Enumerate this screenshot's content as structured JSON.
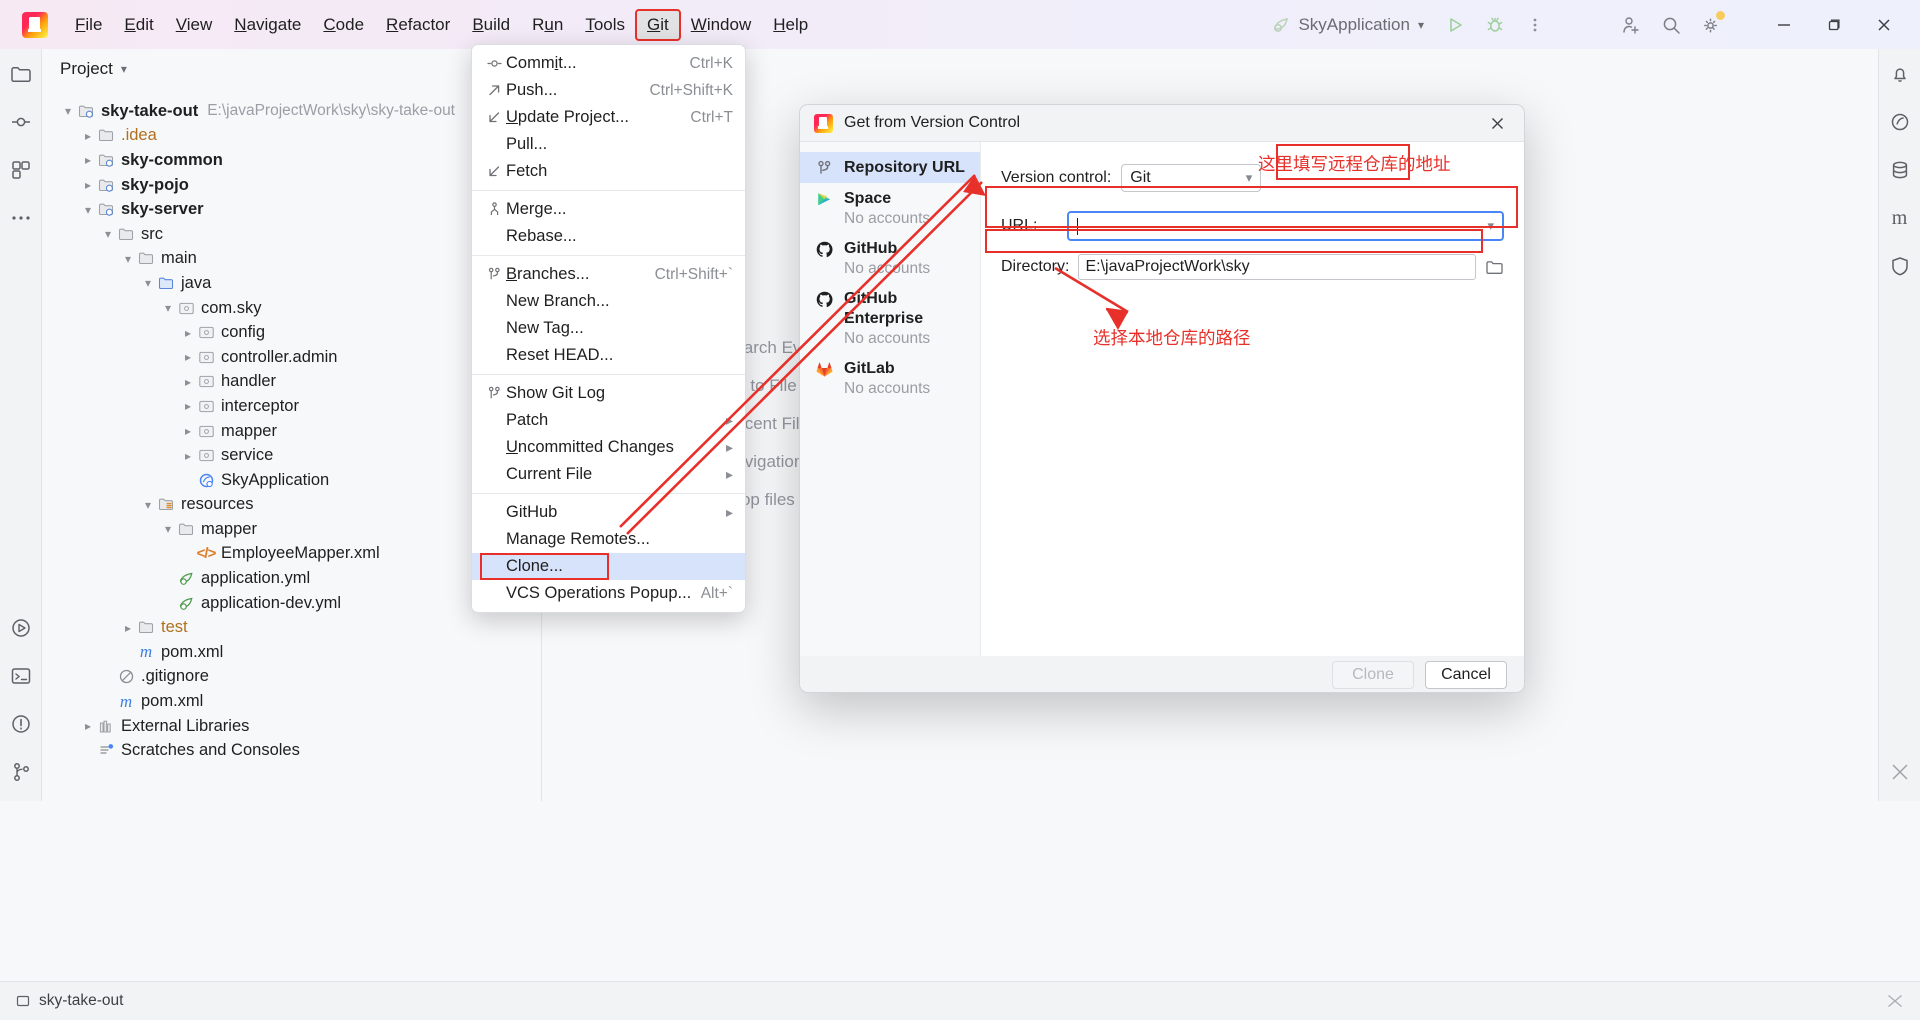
{
  "app": {
    "logo_icon": "intellij-idea-logo",
    "menubar": [
      {
        "label": "File",
        "mnemonic": "F"
      },
      {
        "label": "Edit",
        "mnemonic": "E"
      },
      {
        "label": "View",
        "mnemonic": "V"
      },
      {
        "label": "Navigate",
        "mnemonic": "N"
      },
      {
        "label": "Code",
        "mnemonic": "C"
      },
      {
        "label": "Refactor",
        "mnemonic": "R"
      },
      {
        "label": "Build",
        "mnemonic": "B"
      },
      {
        "label": "Run",
        "mnemonic": "u"
      },
      {
        "label": "Tools",
        "mnemonic": "T"
      },
      {
        "label": "Git",
        "mnemonic": "G"
      },
      {
        "label": "Window",
        "mnemonic": "W"
      },
      {
        "label": "Help",
        "mnemonic": "H"
      }
    ],
    "active_menu": "Git",
    "run_config": "SkyApplication",
    "toolbar_icons": [
      "run-icon",
      "debug-icon",
      "more-vertical-icon",
      "add-user-icon",
      "search-icon",
      "settings-gear-icon"
    ],
    "window_controls": [
      "minimize-icon",
      "maximize-icon",
      "close-icon"
    ]
  },
  "project_panel": {
    "title": "Project",
    "tree": [
      {
        "indent": 0,
        "chevron": "down",
        "icon": "module-folder-icon",
        "label": "sky-take-out",
        "bold": true,
        "sub": "E:\\javaProjectWork\\sky\\sky-take-out"
      },
      {
        "indent": 1,
        "chevron": "right",
        "icon": "folder-icon",
        "label": ".idea",
        "orange": true
      },
      {
        "indent": 1,
        "chevron": "right",
        "icon": "module-folder-icon",
        "label": "sky-common",
        "bold": true
      },
      {
        "indent": 1,
        "chevron": "right",
        "icon": "module-folder-icon",
        "label": "sky-pojo",
        "bold": true
      },
      {
        "indent": 1,
        "chevron": "down",
        "icon": "module-folder-icon",
        "label": "sky-server",
        "bold": true
      },
      {
        "indent": 2,
        "chevron": "down",
        "icon": "folder-icon",
        "label": "src"
      },
      {
        "indent": 3,
        "chevron": "down",
        "icon": "folder-icon",
        "label": "main"
      },
      {
        "indent": 4,
        "chevron": "down",
        "icon": "source-folder-icon",
        "label": "java"
      },
      {
        "indent": 5,
        "chevron": "down",
        "icon": "package-icon",
        "label": "com.sky"
      },
      {
        "indent": 6,
        "chevron": "right",
        "icon": "package-icon",
        "label": "config"
      },
      {
        "indent": 6,
        "chevron": "right",
        "icon": "package-icon",
        "label": "controller.admin"
      },
      {
        "indent": 6,
        "chevron": "right",
        "icon": "package-icon",
        "label": "handler"
      },
      {
        "indent": 6,
        "chevron": "right",
        "icon": "package-icon",
        "label": "interceptor"
      },
      {
        "indent": 6,
        "chevron": "right",
        "icon": "package-icon",
        "label": "mapper"
      },
      {
        "indent": 6,
        "chevron": "right",
        "icon": "package-icon",
        "label": "service"
      },
      {
        "indent": 6,
        "chevron": "none",
        "icon": "spring-boot-class-icon",
        "label": "SkyApplication"
      },
      {
        "indent": 4,
        "chevron": "down",
        "icon": "resources-folder-icon",
        "label": "resources"
      },
      {
        "indent": 5,
        "chevron": "down",
        "icon": "folder-icon",
        "label": "mapper"
      },
      {
        "indent": 6,
        "chevron": "none",
        "icon": "xml-file-icon",
        "label": "EmployeeMapper.xml"
      },
      {
        "indent": 5,
        "chevron": "none",
        "icon": "yaml-file-icon",
        "label": "application.yml"
      },
      {
        "indent": 5,
        "chevron": "none",
        "icon": "yaml-file-icon",
        "label": "application-dev.yml"
      },
      {
        "indent": 3,
        "chevron": "right",
        "icon": "folder-icon",
        "label": "test",
        "orange": true
      },
      {
        "indent": 3,
        "chevron": "none",
        "icon": "maven-file-icon",
        "label": "pom.xml"
      },
      {
        "indent": 2,
        "chevron": "none",
        "icon": "gitignore-icon",
        "label": ".gitignore"
      },
      {
        "indent": 2,
        "chevron": "none",
        "icon": "maven-file-icon",
        "label": "pom.xml"
      },
      {
        "indent": 1,
        "chevron": "right",
        "icon": "library-icon",
        "label": "External Libraries"
      },
      {
        "indent": 1,
        "chevron": "none",
        "icon": "scratches-icon",
        "label": "Scratches and Consoles"
      }
    ]
  },
  "editor_tips": [
    "Search Everywhere  Double Shift",
    "Go to File  Ctrl+Shift+N",
    "Recent Files  Ctrl+E",
    "Navigation Bar  Alt+Home",
    "Drop files here to open"
  ],
  "git_menu": {
    "items": [
      {
        "icon": "commit-icon",
        "label": "Commit...",
        "shortcut": "Ctrl+K",
        "mnemonic": "i"
      },
      {
        "icon": "push-icon",
        "label": "Push...",
        "shortcut": "Ctrl+Shift+K"
      },
      {
        "icon": "update-project-icon",
        "label": "Update Project...",
        "shortcut": "Ctrl+T",
        "mnemonic": "U"
      },
      {
        "icon": "",
        "label": "Pull...",
        "shortcut": ""
      },
      {
        "icon": "fetch-icon",
        "label": "Fetch",
        "shortcut": ""
      },
      {
        "sep": true
      },
      {
        "icon": "merge-icon",
        "label": "Merge...",
        "shortcut": ""
      },
      {
        "icon": "",
        "label": "Rebase...",
        "shortcut": ""
      },
      {
        "sep": true
      },
      {
        "icon": "branch-icon",
        "label": "Branches...",
        "shortcut": "Ctrl+Shift+`",
        "mnemonic": "B"
      },
      {
        "icon": "",
        "label": "New Branch...",
        "shortcut": ""
      },
      {
        "icon": "",
        "label": "New Tag...",
        "shortcut": ""
      },
      {
        "icon": "",
        "label": "Reset HEAD...",
        "shortcut": ""
      },
      {
        "sep": true
      },
      {
        "icon": "branch-icon",
        "label": "Show Git Log",
        "shortcut": ""
      },
      {
        "icon": "",
        "label": "Patch",
        "submenu": true
      },
      {
        "icon": "",
        "label": "Uncommitted Changes",
        "submenu": true,
        "mnemonic": "U"
      },
      {
        "icon": "",
        "label": "Current File",
        "submenu": true
      },
      {
        "sep": true
      },
      {
        "icon": "",
        "label": "GitHub",
        "submenu": true
      },
      {
        "icon": "",
        "label": "Manage Remotes...",
        "shortcut": ""
      },
      {
        "icon": "",
        "label": "Clone...",
        "shortcut": "",
        "selected": true
      },
      {
        "icon": "",
        "label": "VCS Operations Popup...",
        "shortcut": "Alt+`"
      }
    ]
  },
  "dialog": {
    "title": "Get from Version Control",
    "close_icon": "close-icon",
    "sidebar": [
      {
        "icon": "git-branch-icon",
        "name": "Repository URL",
        "note": "",
        "selected": true
      },
      {
        "icon": "jetbrains-space-icon",
        "name": "Space",
        "note": "No accounts"
      },
      {
        "icon": "github-icon",
        "name": "GitHub",
        "note": "No accounts"
      },
      {
        "icon": "github-icon",
        "name": "GitHub Enterprise",
        "note": "No accounts"
      },
      {
        "icon": "gitlab-icon",
        "name": "GitLab",
        "note": "No accounts"
      }
    ],
    "version_control_label": "Version control:",
    "version_control_value": "Git",
    "url_label": "URL:",
    "url_value": "",
    "url_placeholder": "",
    "directory_label": "Directory:",
    "directory_value": "E:\\javaProjectWork\\sky",
    "browse_icon": "folder-browse-icon",
    "clone_button": "Clone",
    "cancel_button": "Cancel"
  },
  "annotations": {
    "url_hint": "这里填写远程仓库的地址",
    "directory_hint": "选择本地仓库的路径",
    "accent_color": "#e8302a"
  },
  "statusbar": {
    "left_icon": "project-icon",
    "left_text": "sky-take-out",
    "right_icon": "notifications-icon"
  }
}
